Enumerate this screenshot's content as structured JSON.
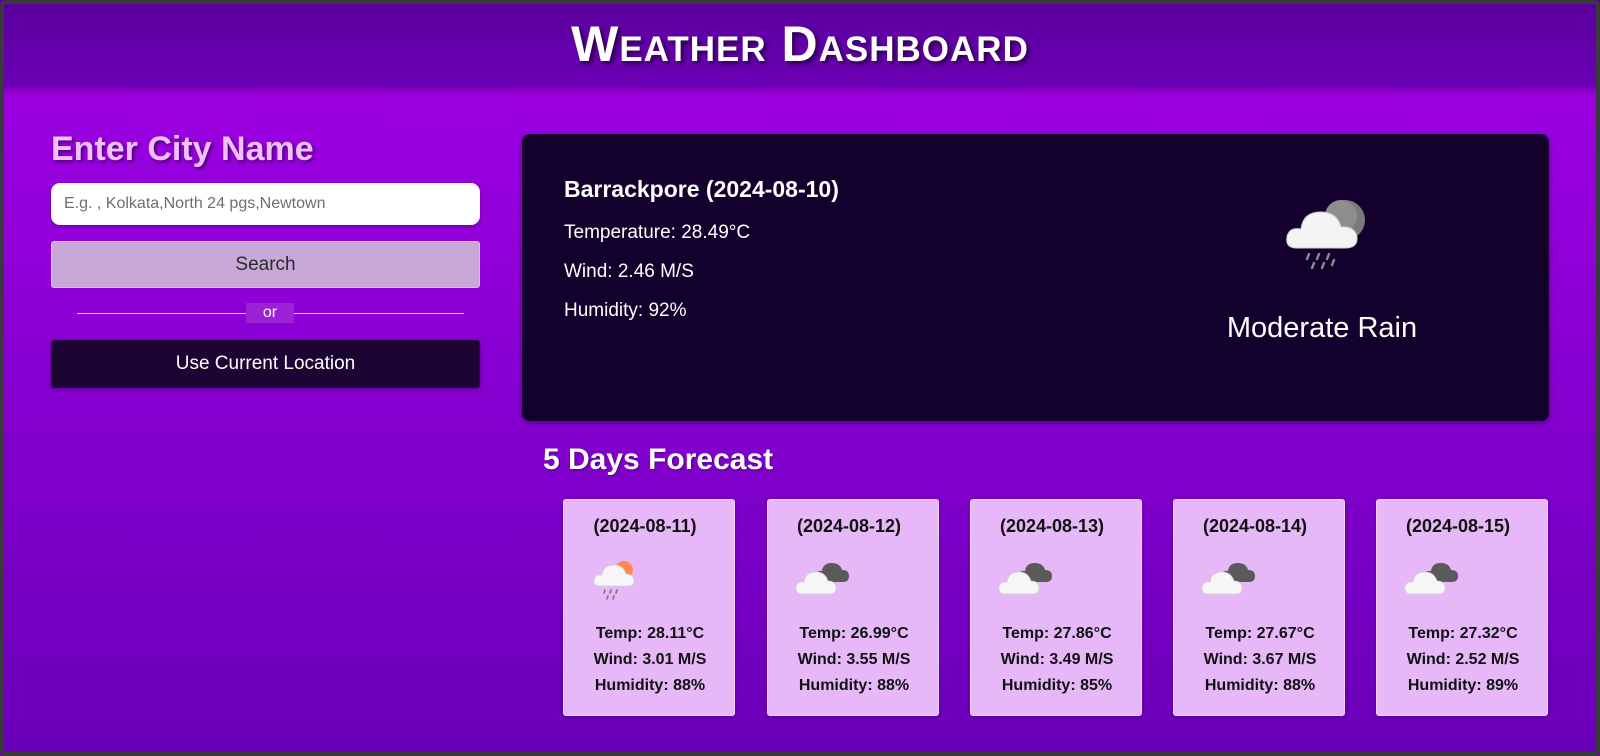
{
  "header": {
    "title": "Weather Dashboard"
  },
  "search": {
    "heading": "Enter City Name",
    "placeholder": "E.g. , Kolkata,North 24 pgs,Newtown",
    "search_label": "Search",
    "divider_text": "or",
    "location_label": "Use Current Location"
  },
  "current": {
    "title": "Barrackpore (2024-08-10)",
    "temperature": "Temperature: 28.49°C",
    "wind": "Wind: 2.46 M/S",
    "humidity": "Humidity: 92%",
    "condition": "Moderate Rain",
    "icon": "rain-cloud-moon-icon"
  },
  "forecast": {
    "title": "5 Days Forecast",
    "days": [
      {
        "date": "(2024-08-11)",
        "temp": "Temp: 28.11°C",
        "wind": "Wind: 3.01 M/S",
        "humidity": "Humidity: 88%",
        "icon": "rain-cloud-sun-icon"
      },
      {
        "date": "(2024-08-12)",
        "temp": "Temp: 26.99°C",
        "wind": "Wind: 3.55 M/S",
        "humidity": "Humidity: 88%",
        "icon": "broken-clouds-icon"
      },
      {
        "date": "(2024-08-13)",
        "temp": "Temp: 27.86°C",
        "wind": "Wind: 3.49 M/S",
        "humidity": "Humidity: 85%",
        "icon": "broken-clouds-icon"
      },
      {
        "date": "(2024-08-14)",
        "temp": "Temp: 27.67°C",
        "wind": "Wind: 3.67 M/S",
        "humidity": "Humidity: 88%",
        "icon": "broken-clouds-icon"
      },
      {
        "date": "(2024-08-15)",
        "temp": "Temp: 27.32°C",
        "wind": "Wind: 2.52 M/S",
        "humidity": "Humidity: 89%",
        "icon": "broken-clouds-icon"
      }
    ]
  },
  "colors": {
    "background": "#9a00dc",
    "header": "#5a009e",
    "heading": "#f0c0ff",
    "current_card": "#14002c",
    "forecast_card": "#e6b8f8",
    "search_button": "#c8a8d6",
    "location_button": "#1c0533",
    "sun": "#ff8a4c"
  }
}
